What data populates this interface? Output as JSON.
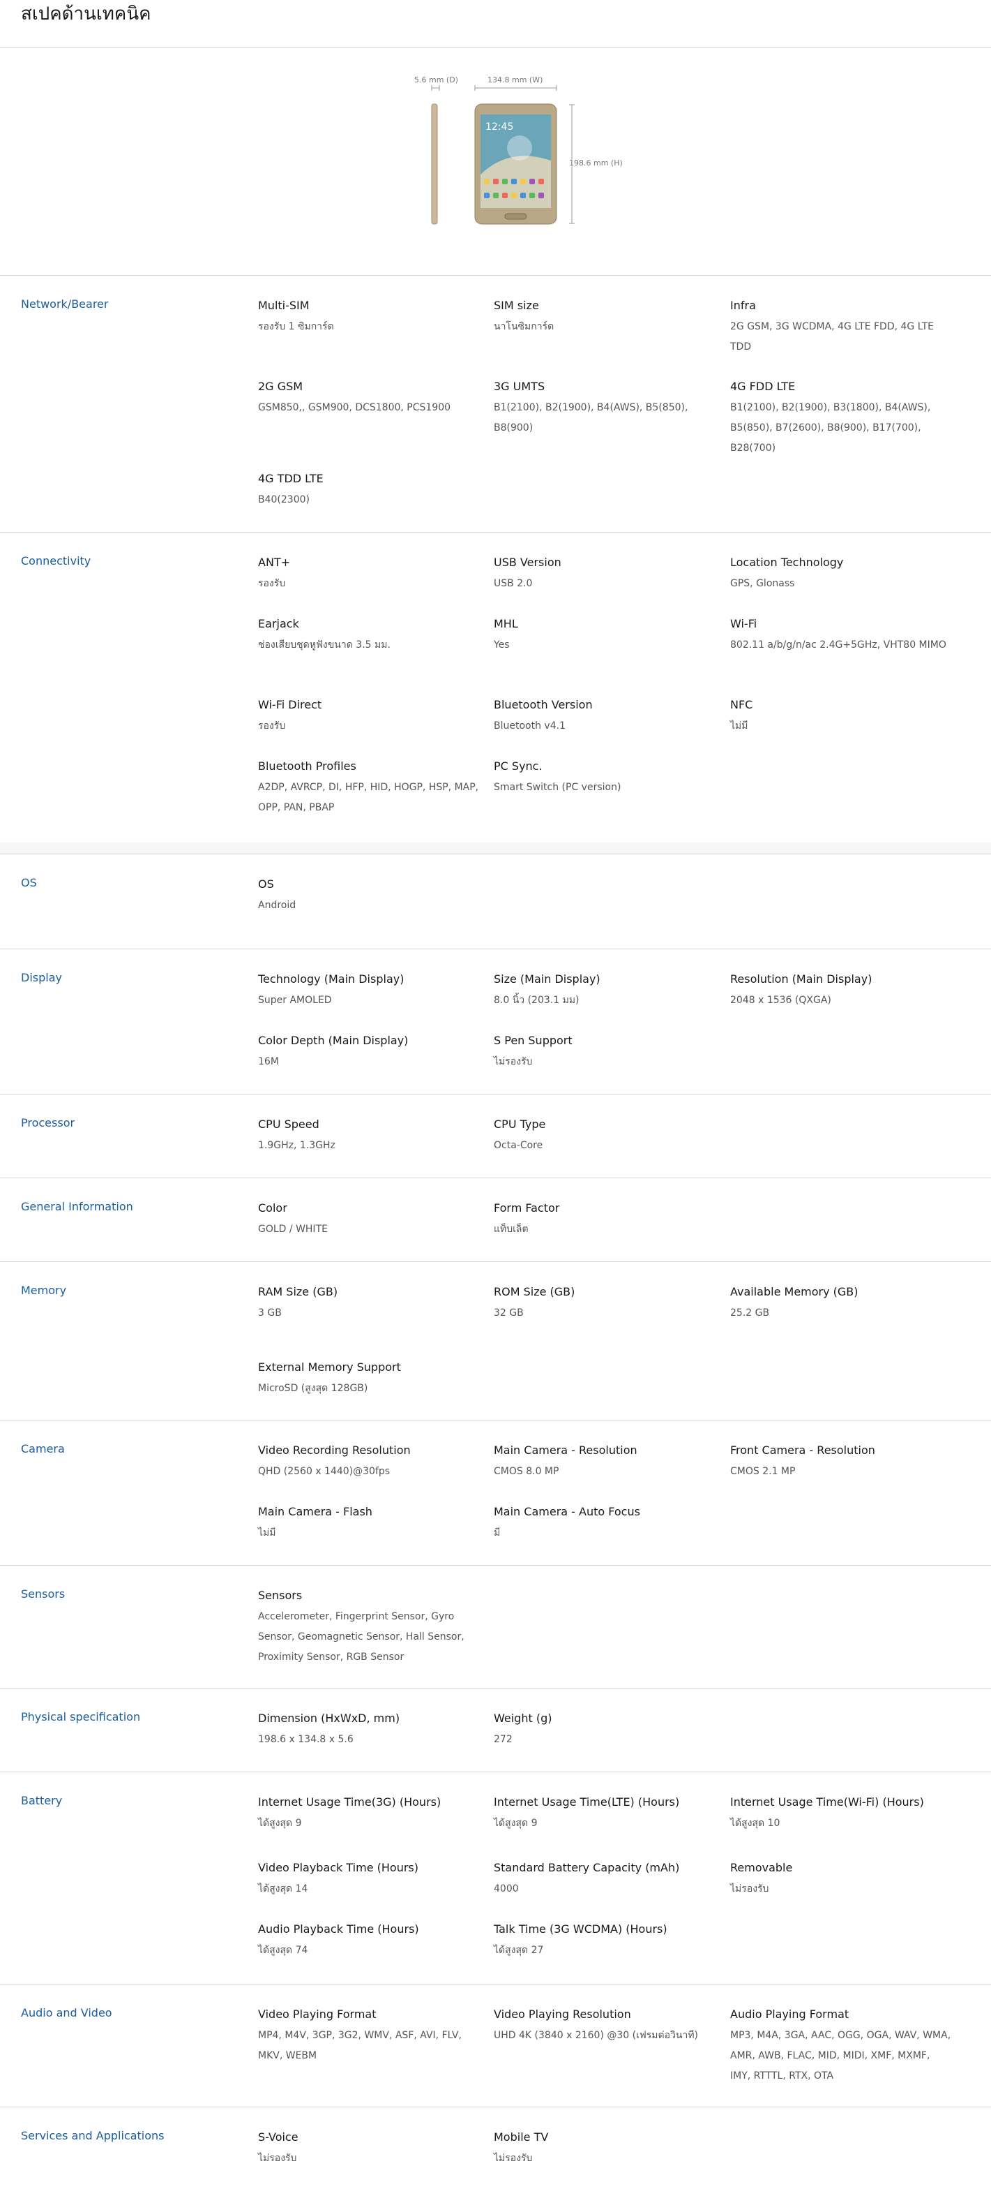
{
  "title": "สเปคด้านเทคนิค",
  "hero": {
    "depth_label": "5.6 mm (D)",
    "width_label": "134.8 mm (W)",
    "height_label": "198.6 mm (H)",
    "device_time": "12:45"
  },
  "sections": [
    {
      "name": "Network/Bearer",
      "specs": [
        {
          "k": "Multi-SIM",
          "v": "รองรับ 1 ซิมการ์ด"
        },
        {
          "k": "SIM size",
          "v": "นาโนซิมการ์ด"
        },
        {
          "k": "Infra",
          "v": "2G GSM, 3G WCDMA, 4G LTE FDD, 4G LTE TDD"
        },
        {
          "k": "2G GSM",
          "v": "GSM850,, GSM900, DCS1800, PCS1900"
        },
        {
          "k": "3G UMTS",
          "v": "B1(2100), B2(1900), B4(AWS), B5(850), B8(900)"
        },
        {
          "k": "4G FDD LTE",
          "v": "B1(2100), B2(1900), B3(1800), B4(AWS), B5(850), B7(2600), B8(900), B17(700), B28(700)"
        },
        {
          "k": "4G TDD LTE",
          "v": "B40(2300)"
        }
      ]
    },
    {
      "name": "Connectivity",
      "specs": [
        {
          "k": "ANT+",
          "v": "รองรับ"
        },
        {
          "k": "USB Version",
          "v": "USB 2.0"
        },
        {
          "k": "Location Technology",
          "v": "GPS, Glonass"
        },
        {
          "k": "Earjack",
          "v": "ช่องเสียบชุดหูฟังขนาด 3.5 มม."
        },
        {
          "k": "MHL",
          "v": "Yes"
        },
        {
          "k": "Wi-Fi",
          "v": "802.11 a/b/g/n/ac 2.4G+5GHz, VHT80 MIMO"
        },
        {
          "k": "Wi-Fi Direct",
          "v": "รองรับ"
        },
        {
          "k": "Bluetooth Version",
          "v": "Bluetooth v4.1"
        },
        {
          "k": "NFC",
          "v": "ไม่มี"
        },
        {
          "k": "Bluetooth Profiles",
          "v": "A2DP, AVRCP, DI, HFP, HID, HOGP, HSP, MAP, OPP, PAN, PBAP"
        },
        {
          "k": "PC Sync.",
          "v": "Smart Switch (PC version)"
        }
      ]
    },
    {
      "name": "OS",
      "specs": [
        {
          "k": "OS",
          "v": "Android"
        }
      ]
    },
    {
      "name": "Display",
      "specs": [
        {
          "k": "Technology (Main Display)",
          "v": "Super AMOLED"
        },
        {
          "k": "Size (Main Display)",
          "v": "8.0 นิ้ว (203.1 มม)"
        },
        {
          "k": "Resolution (Main Display)",
          "v": "2048 x 1536 (QXGA)"
        },
        {
          "k": "Color Depth (Main Display)",
          "v": "16M"
        },
        {
          "k": "S Pen Support",
          "v": "ไม่รองรับ"
        }
      ]
    },
    {
      "name": "Processor",
      "specs": [
        {
          "k": "CPU Speed",
          "v": "1.9GHz, 1.3GHz"
        },
        {
          "k": "CPU Type",
          "v": "Octa-Core"
        }
      ]
    },
    {
      "name": "General Information",
      "specs": [
        {
          "k": "Color",
          "v": "GOLD / WHITE"
        },
        {
          "k": "Form Factor",
          "v": "แท็บเล็ต"
        }
      ]
    },
    {
      "name": "Memory",
      "specs": [
        {
          "k": "RAM Size (GB)",
          "v": "3 GB"
        },
        {
          "k": "ROM Size (GB)",
          "v": "32 GB"
        },
        {
          "k": "Available Memory (GB)",
          "v": "25.2 GB"
        },
        {
          "k": "External Memory Support",
          "v": "MicroSD (สูงสุด 128GB)"
        }
      ]
    },
    {
      "name": "Camera",
      "specs": [
        {
          "k": "Video Recording Resolution",
          "v": "QHD (2560 x 1440)@30fps"
        },
        {
          "k": "Main Camera - Resolution",
          "v": "CMOS 8.0 MP"
        },
        {
          "k": "Front Camera - Resolution",
          "v": "CMOS 2.1 MP"
        },
        {
          "k": "Main Camera - Flash",
          "v": "ไม่มี"
        },
        {
          "k": "Main Camera - Auto Focus",
          "v": "มี"
        }
      ]
    },
    {
      "name": "Sensors",
      "specs": [
        {
          "k": "Sensors",
          "v": "Accelerometer, Fingerprint Sensor, Gyro Sensor, Geomagnetic Sensor, Hall Sensor, Proximity Sensor, RGB Sensor"
        }
      ]
    },
    {
      "name": "Physical specification",
      "specs": [
        {
          "k": "Dimension (HxWxD, mm)",
          "v": "198.6 x 134.8 x 5.6"
        },
        {
          "k": "Weight (g)",
          "v": "272"
        }
      ]
    },
    {
      "name": "Battery",
      "specs": [
        {
          "k": "Internet Usage Time(3G) (Hours)",
          "v": "ได้สูงสุด 9"
        },
        {
          "k": "Internet Usage Time(LTE) (Hours)",
          "v": "ได้สูงสุด 9"
        },
        {
          "k": "Internet Usage Time(Wi-Fi) (Hours)",
          "v": "ได้สูงสุด 10"
        },
        {
          "k": "Video Playback Time (Hours)",
          "v": "ได้สูงสุด 14"
        },
        {
          "k": "Standard Battery Capacity (mAh)",
          "v": "4000"
        },
        {
          "k": "Removable",
          "v": "ไม่รองรับ"
        },
        {
          "k": "Audio Playback Time (Hours)",
          "v": "ได้สูงสุด 74"
        },
        {
          "k": "Talk Time (3G WCDMA) (Hours)",
          "v": "ได้สูงสุด 27"
        }
      ]
    },
    {
      "name": "Audio and Video",
      "specs": [
        {
          "k": "Video Playing Format",
          "v": "MP4, M4V, 3GP, 3G2, WMV, ASF, AVI, FLV, MKV, WEBM"
        },
        {
          "k": "Video Playing Resolution",
          "v": "UHD 4K (3840 x 2160) @30 (เฟรมต่อวินาที)"
        },
        {
          "k": "Audio Playing Format",
          "v": "MP3, M4A, 3GA, AAC, OGG, OGA, WAV, WMA, AMR, AWB, FLAC, MID, MIDI, XMF, MXMF, IMY, RTTTL, RTX, OTA"
        }
      ]
    },
    {
      "name": "Services and Applications",
      "specs": [
        {
          "k": "S-Voice",
          "v": "ไม่รองรับ"
        },
        {
          "k": "Mobile TV",
          "v": "ไม่รองรับ"
        }
      ]
    }
  ]
}
